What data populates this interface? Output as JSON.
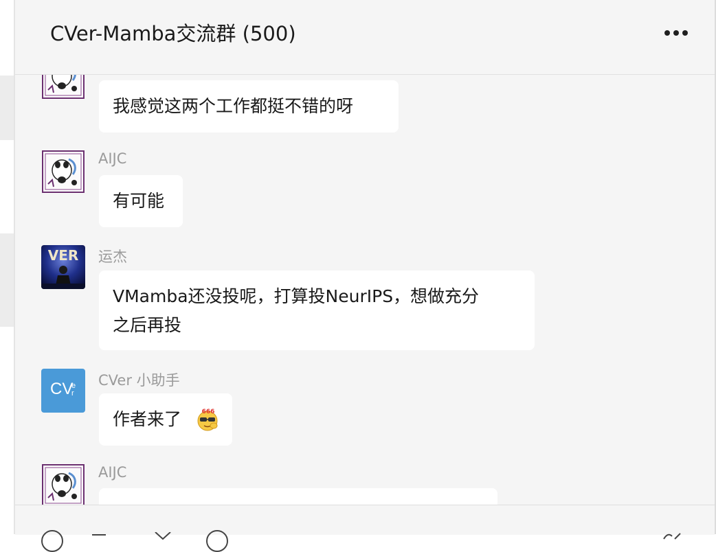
{
  "header": {
    "title": "CVer-Mamba交流群 (500)"
  },
  "messages": [
    {
      "sender": "",
      "avatar": "panda-illustration-avatar",
      "text_lines": [
        "我感觉这两个工作都挺不错的呀"
      ]
    },
    {
      "sender": "AIJC",
      "avatar": "panda-illustration-avatar",
      "text_lines": [
        "有可能"
      ]
    },
    {
      "sender": "运杰",
      "avatar": "ver-stage-photo-avatar",
      "text_lines": [
        "VMamba还没投呢，打算投NeurIPS，想做充分",
        "之后再投"
      ]
    },
    {
      "sender": "CVer 小助手",
      "avatar": "cver-logo-avatar",
      "avatar_text": "CV",
      "avatar_sup": "e",
      "avatar_sub": "r",
      "text_lines": [
        "作者来了"
      ],
      "emoji": "666-emoji",
      "emoji_text": "666"
    },
    {
      "sender": "AIJC",
      "avatar": "panda-illustration-avatar",
      "text_lines": [
        ""
      ]
    }
  ],
  "colors": {
    "chat_background": "#f5f5f5",
    "bubble": "#ffffff",
    "cver_blue": "#4a9ad8",
    "panda_frame": "#6a2f6f"
  },
  "composer": {
    "icons": [
      "emoji-icon",
      "folder-icon",
      "scissors-icon",
      "chat-history-icon",
      "voice-call-icon"
    ]
  }
}
